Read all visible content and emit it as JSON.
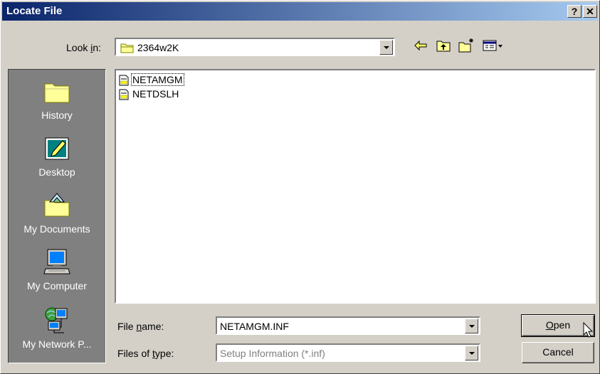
{
  "window": {
    "title": "Locate File",
    "help_label": "?",
    "close_label": "✕"
  },
  "lookin": {
    "label_pre": "Look ",
    "label_key": "i",
    "label_post": "n:",
    "value": "2364w2K"
  },
  "toolbar": {
    "back": "back-arrow-icon",
    "up": "up-folder-icon",
    "new_folder": "new-folder-icon",
    "view": "view-menu-icon"
  },
  "places": [
    {
      "label": "History"
    },
    {
      "label": "Desktop"
    },
    {
      "label": "My Documents"
    },
    {
      "label": "My Computer"
    },
    {
      "label": "My Network P..."
    }
  ],
  "files": [
    {
      "name": "NETAMGM"
    },
    {
      "name": "NETDSLH"
    }
  ],
  "filename": {
    "label_pre": "File ",
    "label_key": "n",
    "label_post": "ame:",
    "value": "NETAMGM.INF"
  },
  "filetype": {
    "label_pre": "Files of ",
    "label_key": "t",
    "label_post": "ype:",
    "value": "Setup Information (*.inf)"
  },
  "buttons": {
    "open_key": "O",
    "open_rest": "pen",
    "cancel": "Cancel"
  },
  "colors": {
    "titlebar_start": "#0a246a",
    "titlebar_end": "#a6caf0",
    "face": "#d4d0c8",
    "places_bg": "#808080"
  }
}
